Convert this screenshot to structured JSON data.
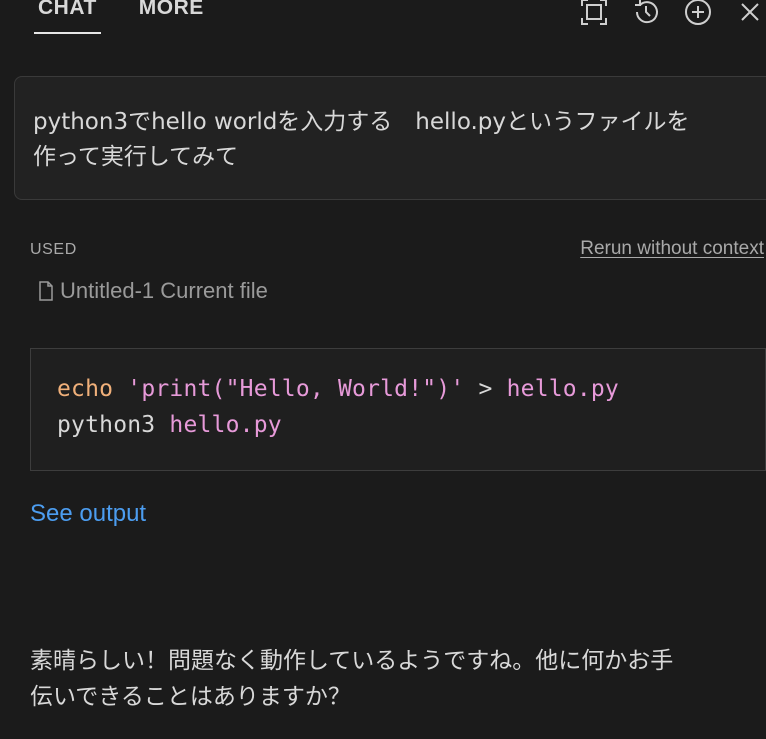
{
  "header": {
    "tabs": [
      {
        "label": "CHAT",
        "active": true
      },
      {
        "label": "MORE",
        "active": false
      }
    ],
    "icons": [
      "fullscreen-icon",
      "history-icon",
      "add-icon",
      "close-icon"
    ]
  },
  "prompt": {
    "text": "python3でhello worldを入力する　hello.pyというファイルを\n作って実行してみて"
  },
  "context": {
    "used_label": "USED",
    "rerun_label": "Rerun without context",
    "file_icon": "file-icon",
    "file_label": "Untitled-1 Current file"
  },
  "code": {
    "line1": {
      "cmd": "echo",
      "str": "'print(\"Hello, World!\")'",
      "op": ">",
      "arg": "hello.py"
    },
    "line2": {
      "cmd": "python3",
      "arg": "hello.py"
    }
  },
  "see_output_label": "See output",
  "reply": {
    "text": "素晴らしい！問題なく動作しているようですね。他に何かお手\n伝いできることはありますか？"
  },
  "colors": {
    "background": "#1b1b1b",
    "link": "#4c9df0",
    "keyword": "#f0b07a",
    "string": "#e79ad9"
  }
}
